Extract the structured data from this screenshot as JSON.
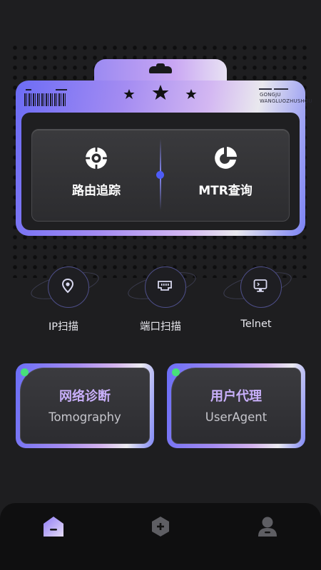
{
  "top_card": {
    "brand_line1": "GONGJU",
    "brand_line2": "WANGLUOZHUSHOU",
    "actions": [
      {
        "label": "路由追踪",
        "icon": "target-icon"
      },
      {
        "label": "MTR查询",
        "icon": "pie-chart-icon"
      }
    ]
  },
  "tools": [
    {
      "label": "IP扫描",
      "icon": "location-pin-icon"
    },
    {
      "label": "端口扫描",
      "icon": "network-port-icon"
    },
    {
      "label": "Telnet",
      "icon": "monitor-icon"
    }
  ],
  "cards": [
    {
      "title": "网络诊断",
      "subtitle": "Tomography"
    },
    {
      "title": "用户代理",
      "subtitle": "UserAgent"
    }
  ],
  "nav": [
    {
      "name": "home-icon",
      "active": true
    },
    {
      "name": "add-hexagon-icon",
      "active": false
    },
    {
      "name": "user-icon",
      "active": false
    }
  ],
  "colors": {
    "background": "#1e1e20",
    "accent": "#6c6cf5",
    "status_dot": "#47e07a",
    "card_title": "#c9b0fb"
  }
}
